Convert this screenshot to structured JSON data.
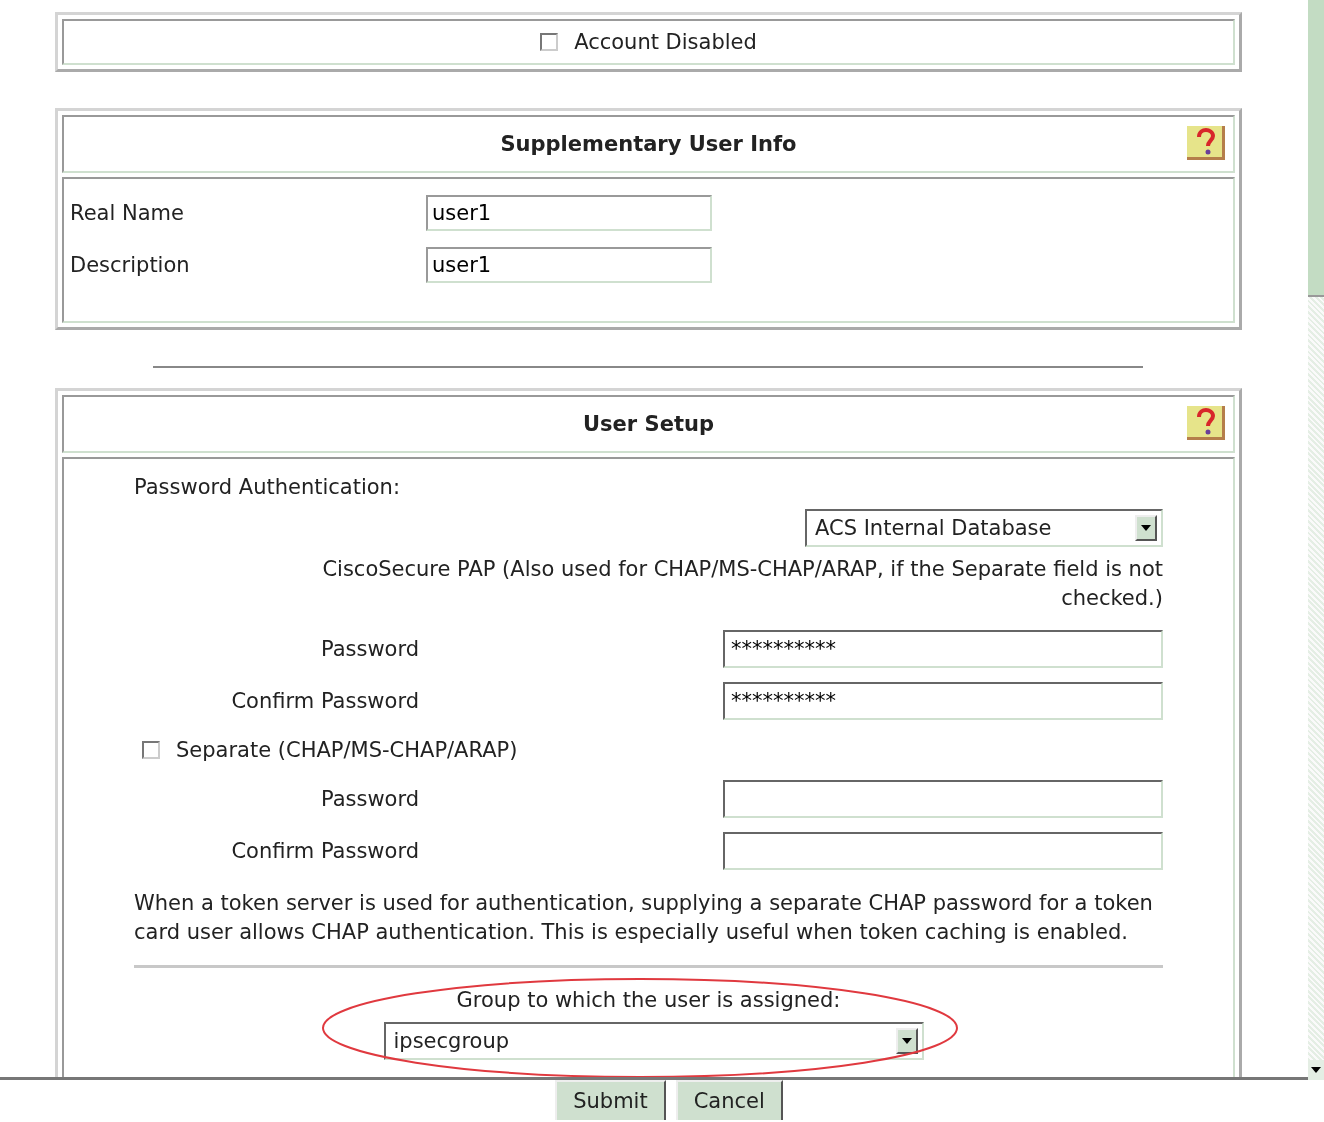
{
  "account_disabled": {
    "label": "Account Disabled",
    "checked": false
  },
  "supplementary": {
    "title": "Supplementary User Info",
    "fields": [
      {
        "label": "Real Name",
        "value": "user1"
      },
      {
        "label": "Description",
        "value": "user1"
      }
    ]
  },
  "user_setup": {
    "title": "User Setup",
    "password_auth_label": "Password Authentication:",
    "auth_select": "ACS Internal Database",
    "pap_note": "CiscoSecure PAP (Also used for CHAP/MS-CHAP/ARAP, if the Separate field is not checked.)",
    "pap_fields": [
      {
        "label": "Password",
        "value": "**********"
      },
      {
        "label": "Confirm Password",
        "value": "**********"
      }
    ],
    "separate": {
      "label": "Separate (CHAP/MS-CHAP/ARAP)",
      "checked": false
    },
    "chap_fields": [
      {
        "label": "Password"
      },
      {
        "label": "Confirm Password"
      }
    ],
    "token_note": "When a token server is used for authentication, supplying a separate CHAP password for a token card user allows CHAP authentication. This is especially useful when token caching is enabled.",
    "group_label": "Group to which the user is assigned:",
    "group_select": "ipsecgroup"
  },
  "buttons": [
    "Submit",
    "Cancel"
  ]
}
